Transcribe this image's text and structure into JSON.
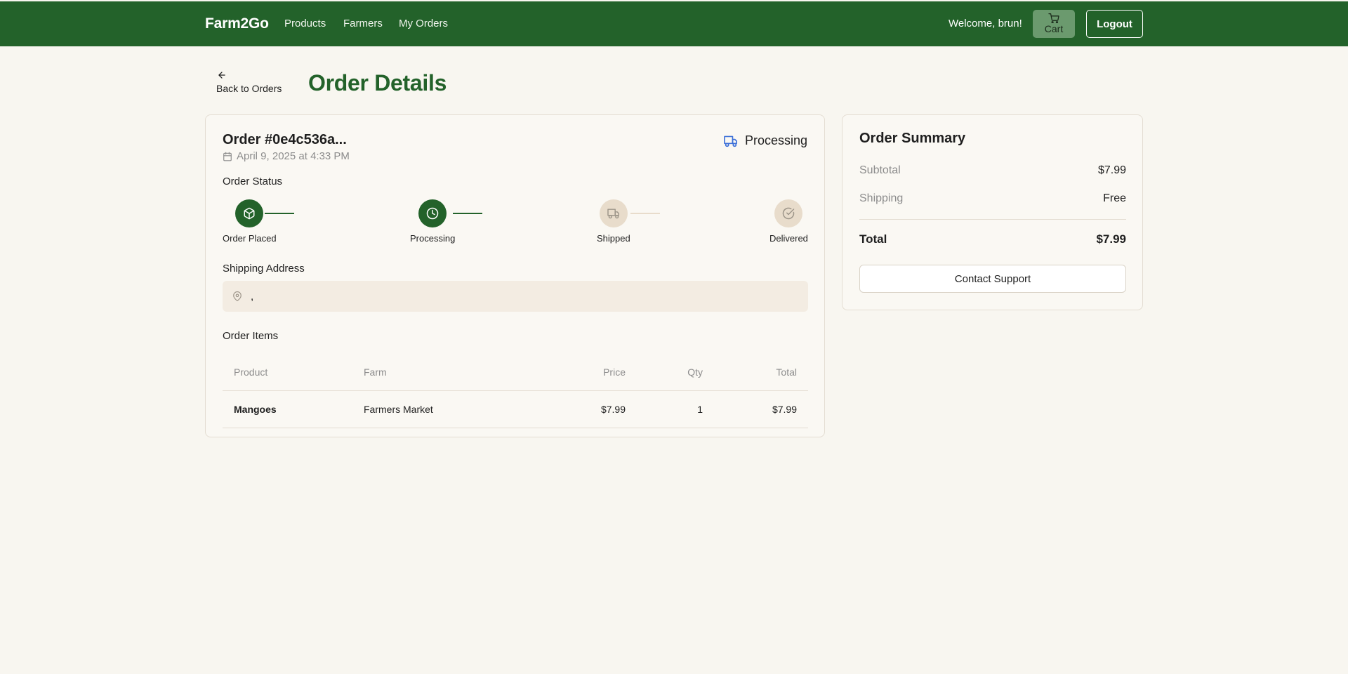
{
  "navbar": {
    "brand": "Farm2Go",
    "links": [
      "Products",
      "Farmers",
      "My Orders"
    ],
    "welcome": "Welcome, brun!",
    "cart_label": "Cart",
    "logout_label": "Logout"
  },
  "header": {
    "back_label": "Back to Orders",
    "title": "Order Details"
  },
  "order": {
    "id": "Order #0e4c536a...",
    "date": "April 9, 2025 at 4:33 PM",
    "status": "Processing",
    "status_section_label": "Order Status",
    "steps": [
      {
        "label": "Order Placed",
        "icon": "package-icon",
        "state": "done"
      },
      {
        "label": "Processing",
        "icon": "clock-icon",
        "state": "done"
      },
      {
        "label": "Shipped",
        "icon": "truck-icon",
        "state": "todo"
      },
      {
        "label": "Delivered",
        "icon": "check-circle-icon",
        "state": "todo"
      }
    ],
    "shipping_label": "Shipping Address",
    "shipping_address": ",",
    "items_label": "Order Items",
    "table": {
      "headers": [
        "Product",
        "Farm",
        "Price",
        "Qty",
        "Total"
      ],
      "rows": [
        [
          "Mangoes",
          "Farmers Market",
          "$7.99",
          "1",
          "$7.99"
        ]
      ]
    }
  },
  "summary": {
    "title": "Order Summary",
    "subtotal_label": "Subtotal",
    "subtotal_value": "$7.99",
    "shipping_label": "Shipping",
    "shipping_value": "Free",
    "total_label": "Total",
    "total_value": "$7.99",
    "contact_label": "Contact Support"
  },
  "colors": {
    "brand_green": "#23622a",
    "background": "#f8f6f0",
    "status_blue": "#3b6fd8",
    "step_inactive": "#e8dccb"
  }
}
